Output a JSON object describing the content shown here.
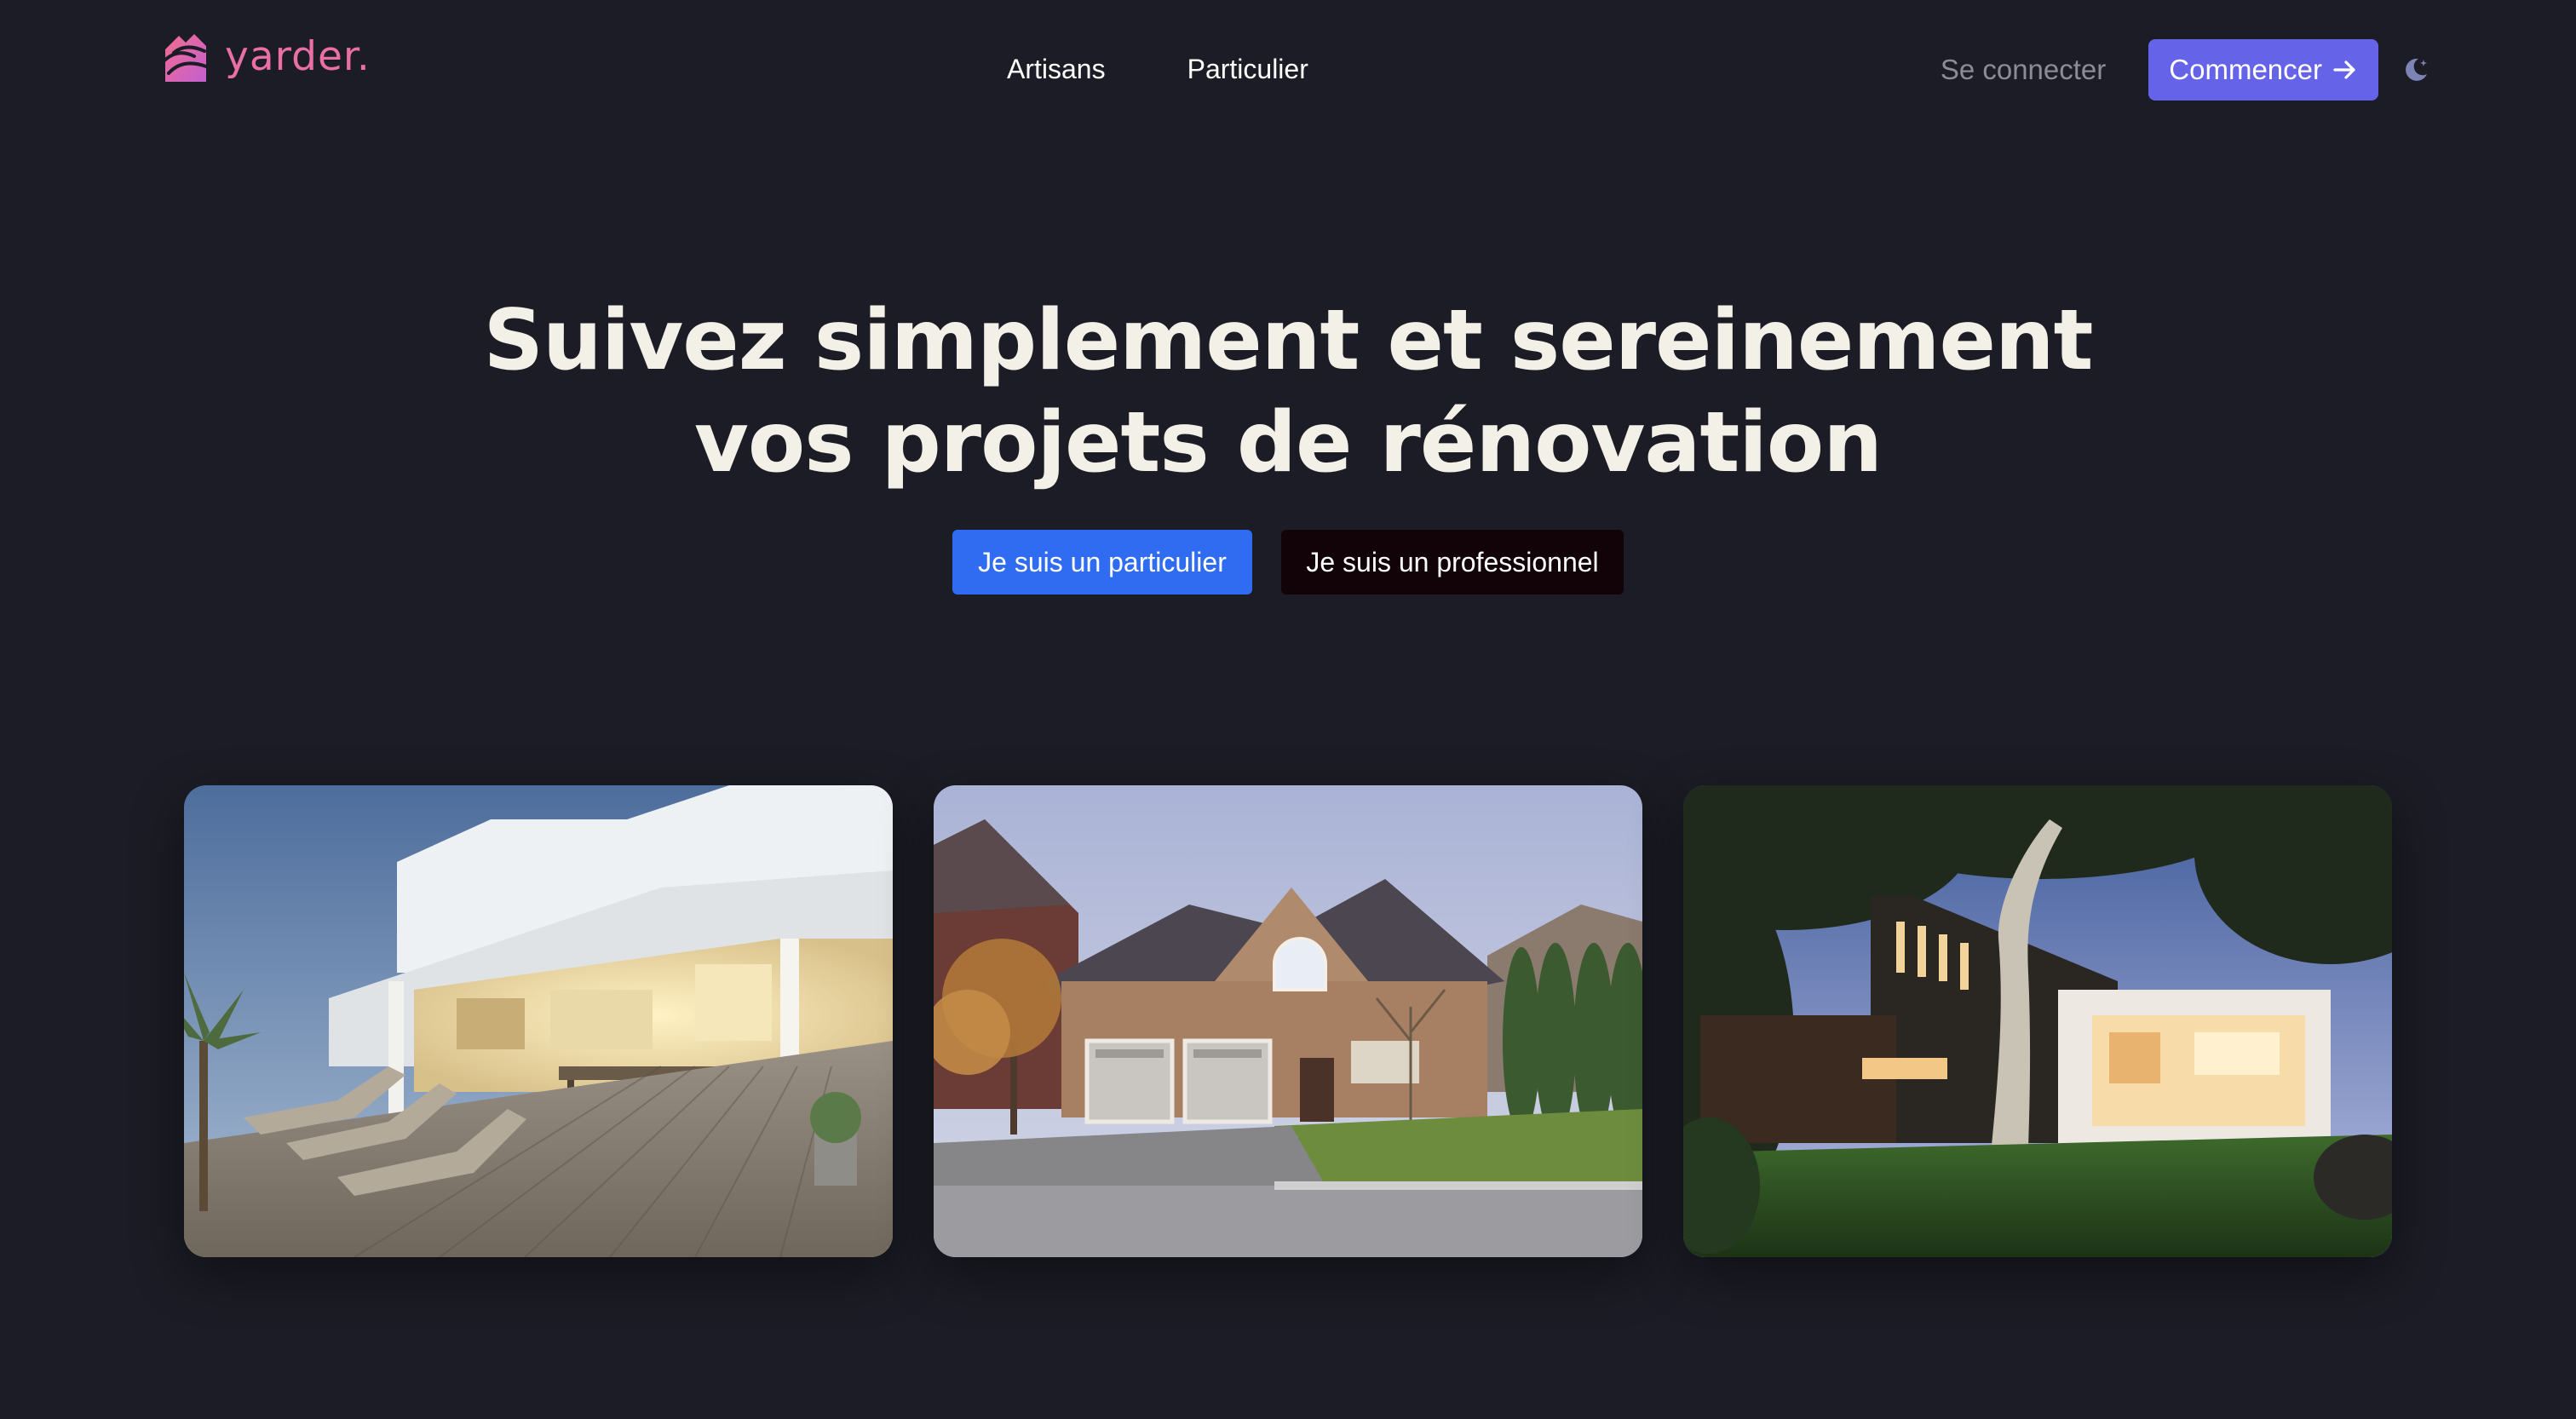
{
  "brand": {
    "name": "yarder.",
    "logo_icon": "house-stripes-logo",
    "color": "#ea6fa6"
  },
  "nav": {
    "links": [
      {
        "label": "Artisans"
      },
      {
        "label": "Particulier"
      }
    ],
    "login_label": "Se connecter",
    "start_label": "Commencer",
    "start_icon": "arrow-right-icon",
    "theme_toggle_icon": "moon-icon"
  },
  "hero": {
    "title_line1": "Suivez simplement et sereinement",
    "title_line2": "vos projets de rénovation",
    "cta_particulier": "Je suis un particulier",
    "cta_pro": "Je suis un professionnel"
  },
  "gallery": {
    "images": [
      {
        "subject": "white beach house with wooden deck and sun loungers at dusk"
      },
      {
        "subject": "brick suburban house with double garage and driveway"
      },
      {
        "subject": "modern black timber house with lit interior, lawn and eucalyptus tree"
      }
    ]
  },
  "colors": {
    "background": "#1c1c26",
    "accent": "#6564e8",
    "primary_cta": "#2f6cf1",
    "dark_cta": "#120308",
    "hero_text": "#f3f0e7"
  }
}
